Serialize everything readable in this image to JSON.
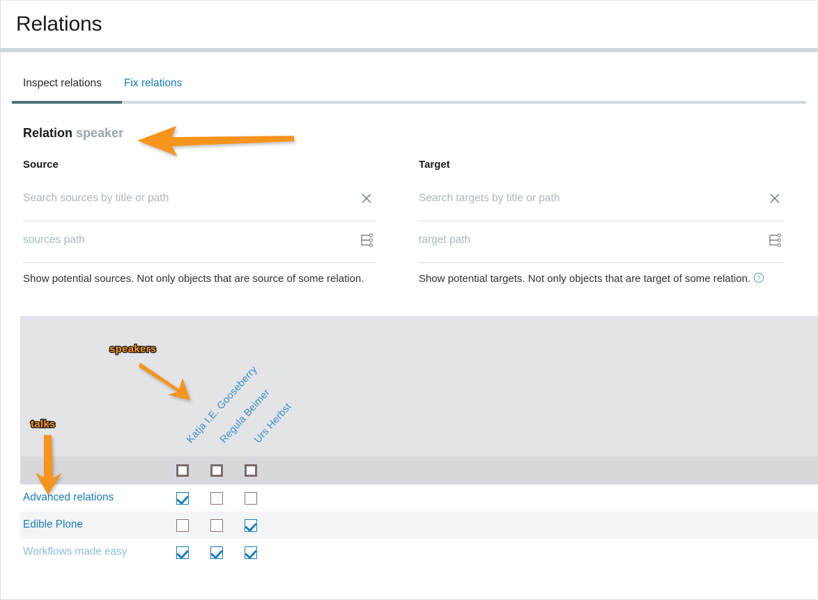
{
  "header": {
    "title": "Relations"
  },
  "tabs": [
    {
      "label": "Inspect relations",
      "active": true
    },
    {
      "label": "Fix relations",
      "active": false
    }
  ],
  "relation": {
    "prefix": "Relation",
    "name": "speaker"
  },
  "source": {
    "label": "Source",
    "search": {
      "value": "",
      "placeholder": "Search sources by title or path"
    },
    "path": {
      "value": "",
      "placeholder": "sources path"
    },
    "help": "Show potential sources. Not only objects that are source of some relation.",
    "clear_icon": "close-icon",
    "path_icon": "tree-path-icon"
  },
  "target": {
    "label": "Target",
    "search": {
      "value": "",
      "placeholder": "Search targets by title or path"
    },
    "path": {
      "value": "",
      "placeholder": "target path"
    },
    "help": "Show potential targets. Not only objects that are target of some relation.",
    "help_icon": "question-circle-icon",
    "clear_icon": "close-icon",
    "path_icon": "tree-path-icon"
  },
  "matrix": {
    "columns": [
      "Katja I.E. Gooseberry",
      "Regula Beimer",
      "Urs Herbst"
    ],
    "header_checkboxes": [
      false,
      false,
      false
    ],
    "rows": [
      {
        "label": "Advanced relations",
        "faded": false,
        "checks": [
          true,
          false,
          false
        ]
      },
      {
        "label": "Edible Plone",
        "faded": false,
        "checks": [
          false,
          false,
          true
        ]
      },
      {
        "label": "Workflows made easy",
        "faded": true,
        "checks": [
          true,
          true,
          true
        ]
      }
    ]
  },
  "annotations": [
    {
      "text": "speakers",
      "name": "annotation-speakers"
    },
    {
      "text": "talks",
      "name": "annotation-talks"
    }
  ],
  "colors": {
    "accent_link": "#1a7bb9",
    "annotation_orange": "#f7941e",
    "active_tab_bar": "#4d6f71",
    "header_rule": "#ccd8da"
  }
}
